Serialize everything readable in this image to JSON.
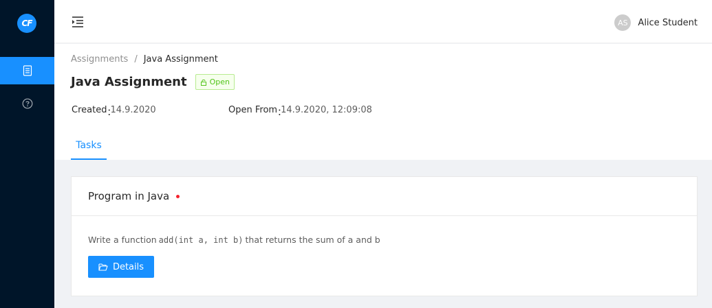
{
  "sidebar": {
    "logo_text": "CF",
    "items": [
      {
        "icon": "document-icon",
        "active": true
      },
      {
        "icon": "question-circle-icon",
        "active": false
      }
    ]
  },
  "header": {
    "trigger_icon": "menu-unfold-icon",
    "user": {
      "initials": "AS",
      "name": "Alice Student"
    }
  },
  "breadcrumb": {
    "root": "Assignments",
    "separator": "/",
    "current": "Java Assignment"
  },
  "assignment": {
    "title": "Java Assignment",
    "status": "Open",
    "created_label": "Created",
    "created_value": "14.9.2020",
    "open_from_label": "Open From",
    "open_from_value": "14.9.2020, 12:09:08",
    "colon": "："
  },
  "tabs": [
    {
      "label": "Tasks",
      "active": true
    }
  ],
  "task": {
    "title": "Program in Java",
    "desc_prefix": "Write a function",
    "desc_code": "add(int a, int b)",
    "desc_suffix": "that returns the sum of a and b",
    "details_label": "Details"
  },
  "colors": {
    "primary": "#1890ff",
    "sider": "#001529",
    "success": "#52c41a",
    "danger": "#f5222d"
  }
}
